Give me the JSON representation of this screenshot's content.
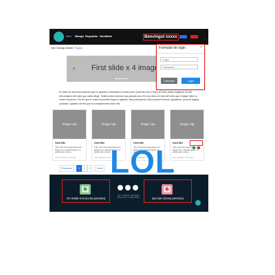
{
  "navbar": {
    "items": [
      "Idee",
      "Manga",
      "Regulatio",
      "Noutăties"
    ],
    "welcome": "Benvingut xxxxx"
  },
  "breadcrumb": {
    "home": "Inici",
    "section": "Manga Gabriel",
    "current": "Pagina"
  },
  "carousel": {
    "caption": "First slide x 4 images",
    "prev_icon": "chevron-left-icon",
    "next_icon": "chevron-right-icon"
  },
  "login": {
    "title": "Formular de login",
    "close": "×",
    "login_placeholder": "Login",
    "password_placeholder": "Password",
    "cancel_label": "Cancelar",
    "submit_label": "Login"
  },
  "intro_text": "El vídeo és una eina poderosa que us ajudarà a demostrar el vostre punt. Quan feu clic a Vídeo en línia, podeu enganxar el codi d'incrustació del vídeo que voleu afegir. També podeu escriure una paraula clau i fer una cerca en línia del vídeo que s'adapti millor al vostre document. Per fer que el vostre document tingui un aspecte més professional, Word permet incloure capçaleres, peus de pàgina, portades i quadres de text que es complementen entre ells.",
  "cards": [
    {
      "image": "Image cap",
      "title": "Card title",
      "text": "This card has supporting text below as a natural lead-in to additional content.",
      "meta": "Last updated 3 mins ago"
    },
    {
      "image": "Image cap",
      "title": "Card title",
      "text": "This card has supporting text below as a natural lead-in to additional content.",
      "meta": "Last updated 3 mins ago"
    },
    {
      "image": "Image cap",
      "title": "Card title",
      "text": "This card has supporting text below as a natural lead-in to additional content.",
      "meta": "Last updated 3 mins ago"
    },
    {
      "image": "Image cap",
      "title": "Card title",
      "text": "This card has supporting text below as a natural lead-in to additional content.",
      "meta": "Last updated 3 mins ago"
    }
  ],
  "overlay_text": "LOL",
  "pagination": {
    "previous": "Previous",
    "pages": [
      "1",
      "2",
      "3"
    ],
    "next": "Next"
  },
  "footer": {
    "left_label": "On trobar-nos (icona persona)",
    "right_label": "Qui som (icona persona)",
    "small_text": "Inici · Contacte · Avís legal · Termes d'ús · Privacy Policy",
    "social_icons": [
      "facebook-icon",
      "instagram-icon",
      "twitter-icon"
    ]
  },
  "colors": {
    "navbar_bg": "#111111",
    "accent": "#27b3b3",
    "highlight_border": "#e02020",
    "link": "#1e73e8",
    "overlay_text": "#1e88e5",
    "footer_bg": "#0b1d2b"
  }
}
